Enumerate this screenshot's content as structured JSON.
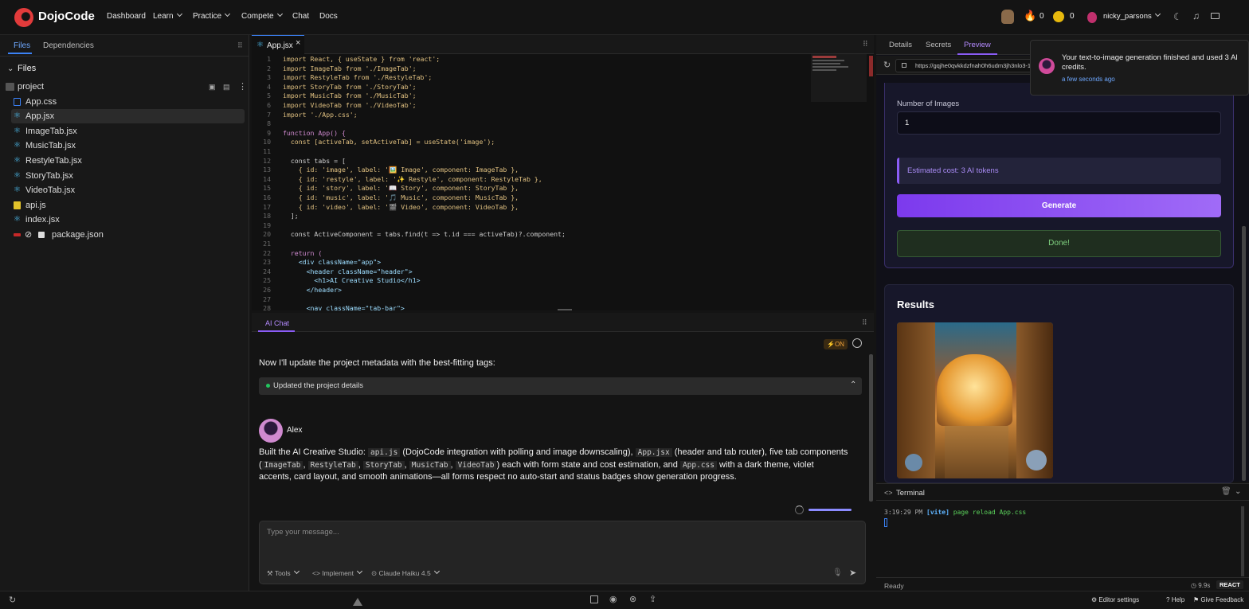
{
  "brand": {
    "name": "DojoCode",
    "accent": "#e23b3b"
  },
  "nav": {
    "dashboard": "Dashboard",
    "learn": "Learn",
    "practice": "Practice",
    "compete": "Compete",
    "chat": "Chat",
    "docs": "Docs"
  },
  "user": {
    "streak": "0",
    "coins": "0",
    "username": "nicky_parsons"
  },
  "sidebar": {
    "tabs": [
      "Files",
      "Dependencies"
    ],
    "files_header": "Files",
    "project": "project",
    "files": [
      "App.css",
      "App.jsx",
      "ImageTab.jsx",
      "MusicTab.jsx",
      "RestyleTab.jsx",
      "StoryTab.jsx",
      "VideoTab.jsx",
      "api.js",
      "index.jsx",
      "package.json"
    ],
    "selected": "App.jsx"
  },
  "editor": {
    "tab": "App.jsx",
    "line_numbers": [
      "1",
      "2",
      "3",
      "4",
      "5",
      "6",
      "7",
      "8",
      "9",
      "10",
      "11",
      "12",
      "13",
      "14",
      "15",
      "16",
      "17",
      "18",
      "19",
      "20",
      "21",
      "22",
      "23",
      "24",
      "25",
      "26",
      "27",
      "28"
    ],
    "lines": [
      "import React, { useState } from 'react';",
      "import ImageTab from './ImageTab';",
      "import RestyleTab from './RestyleTab';",
      "import StoryTab from './StoryTab';",
      "import MusicTab from './MusicTab';",
      "import VideoTab from './VideoTab';",
      "import './App.css';",
      "",
      "function App() {",
      "  const [activeTab, setActiveTab] = useState('image');",
      "",
      "  const tabs = [",
      "    { id: 'image', label: '🖼️ Image', component: ImageTab },",
      "    { id: 'restyle', label: '✨ Restyle', component: RestyleTab },",
      "    { id: 'story', label: '📖 Story', component: StoryTab },",
      "    { id: 'music', label: '🎵 Music', component: MusicTab },",
      "    { id: 'video', label: '🎬 Video', component: VideoTab },",
      "  ];",
      "",
      "  const ActiveComponent = tabs.find(t => t.id === activeTab)?.component;",
      "",
      "  return (",
      "    <div className=\"app\">",
      "      <header className=\"header\">",
      "        <h1>AI Creative Studio</h1>",
      "      </header>",
      "",
      "      <nav className=\"tab-bar\">"
    ]
  },
  "chat": {
    "tab": "AI Chat",
    "badge": "⚡ON",
    "intro": "Now I'll update the project metadata with the best-fitting tags:",
    "tool_status": "Updated the project details",
    "author": "Alex",
    "message": {
      "p1": "Built the AI Creative Studio: ",
      "c1": "api.js",
      "p2": " (DojoCode integration with polling and image downscaling), ",
      "c2": "App.jsx",
      "p3": " (header and tab router), five tab components (",
      "c3": "ImageTab",
      "s1": ", ",
      "c4": "RestyleTab",
      "s2": ", ",
      "c5": "StoryTab",
      "s3": ", ",
      "c6": "MusicTab",
      "s4": ", ",
      "c7": "VideoTab",
      "p4": ") each with form state and cost estimation, and ",
      "c8": "App.css",
      "p5": " with a dark theme, violet accents, card layout, and smooth animations—all forms respect no auto-start and status badges show generation progress."
    },
    "input_placeholder": "Type your message...",
    "tools": "Tools",
    "mode": "Implement",
    "model": "Claude Haiku 4.5"
  },
  "right": {
    "tabs": [
      "Details",
      "Secrets",
      "Preview"
    ],
    "active_tab": "Preview",
    "url": "https://gqjhe0qvkkdzfnah0h6udm3jh3nlo3-1",
    "num_images_label": "Number of Images",
    "num_images_value": "1",
    "cost": "Estimated cost: 3 AI tokens",
    "generate": "Generate",
    "done": "Done!",
    "results": "Results"
  },
  "toast": {
    "text": "Your text-to-image generation finished and used 3 AI credits.",
    "time": "a few seconds ago"
  },
  "terminal": {
    "title": "Terminal",
    "time": "3:19:29 PM",
    "tag": "[vite]",
    "msg": "page reload App.css",
    "status": "Ready",
    "timer": "9.9s",
    "framework": "REACT"
  },
  "bottom": {
    "editor_settings": "Editor settings",
    "help": "Help",
    "feedback": "Give Feedback"
  }
}
